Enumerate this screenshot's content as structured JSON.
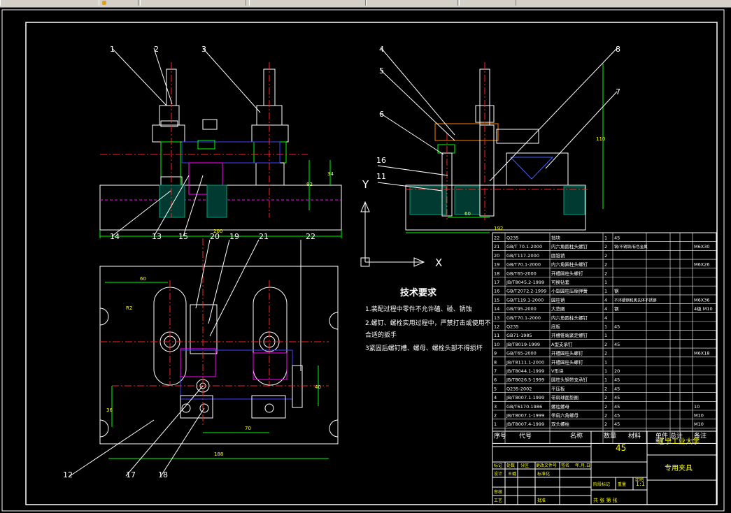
{
  "toolbar": {
    "segments": [
      "",
      "",
      "",
      "",
      "",
      ""
    ]
  },
  "callouts": [
    "1",
    "2",
    "3",
    "4",
    "5",
    "6",
    "7",
    "8",
    "11",
    "12",
    "13",
    "14",
    "15",
    "16",
    "17",
    "18",
    "19",
    "20",
    "21",
    "22"
  ],
  "axes": {
    "y": "Y",
    "x": "X"
  },
  "dims": {
    "d_top_total": "200",
    "d_top_h1": "82",
    "d_top_h2": "34",
    "d_side_h": "110",
    "d_side_w": "192",
    "d_side_60": "60",
    "d_plan_w": "188",
    "d_plan_70": "70",
    "d_plan_60": "60",
    "d_plan_36": "36",
    "d_plan_40": "40",
    "d_plan_r": "R2"
  },
  "tech": {
    "title": "技术要求",
    "line1": "1.装配过程中零件不允许磕、碰、锈蚀",
    "line2": "2.螺钉、螺栓实用过程中，严禁打击或使用不",
    "line3": "合适的扳手",
    "line4": "3紧固后螺钉槽、螺母、螺栓头部不得损坏"
  },
  "bom": {
    "rows": [
      {
        "no": "22",
        "code": "Q235",
        "name": "挡块",
        "qty": "1",
        "mat": "45",
        "note": ""
      },
      {
        "no": "21",
        "code": "GB/T 70.1-2000",
        "name": "内六角圆柱头螺钉",
        "qty": "2",
        "mat": "钢/不锈钢/有色金属",
        "note": "M6X30"
      },
      {
        "no": "20",
        "code": "GB/T117-2000",
        "name": "圆锥销",
        "qty": "2",
        "mat": "",
        "note": ""
      },
      {
        "no": "19",
        "code": "GB/T70.1-2000",
        "name": "内六角圆柱头螺钉",
        "qty": "2",
        "mat": "",
        "note": "M6X26"
      },
      {
        "no": "18",
        "code": "GB/T65-2000",
        "name": "开槽圆柱头螺钉",
        "qty": "2",
        "mat": "",
        "note": ""
      },
      {
        "no": "17",
        "code": "JB/T8045.2-1999",
        "name": "可换钻套",
        "qty": "1",
        "mat": "",
        "note": ""
      },
      {
        "no": "16",
        "code": "GB/T2072.2-1999",
        "name": "小型圆柱压缩弹簧",
        "qty": "1",
        "mat": "钢",
        "note": ""
      },
      {
        "no": "15",
        "code": "GB/T119.1-2000",
        "name": "圆柱销",
        "qty": "4",
        "mat": "不淬硬钢和奥氏体不锈钢",
        "note": "M6X36"
      },
      {
        "no": "14",
        "code": "GB/T95-2000",
        "name": "大垫圈",
        "qty": "4",
        "mat": "钢",
        "note": "4级 M10"
      },
      {
        "no": "13",
        "code": "GB/T70.1-2000",
        "name": "内六角圆柱头螺钉",
        "qty": "4",
        "mat": "",
        "note": ""
      },
      {
        "no": "12",
        "code": "Q235",
        "name": "底板",
        "qty": "1",
        "mat": "45",
        "note": ""
      },
      {
        "no": "11",
        "code": "GB71-1985",
        "name": "开槽锥端紧定螺钉",
        "qty": "1",
        "mat": "",
        "note": ""
      },
      {
        "no": "10",
        "code": "JB/T8019-1999",
        "name": "A型支承钉",
        "qty": "2",
        "mat": "45",
        "note": ""
      },
      {
        "no": "9",
        "code": "GB/T65-2000",
        "name": "开槽圆柱头螺钉",
        "qty": "2",
        "mat": "",
        "note": "M6X18"
      },
      {
        "no": "8",
        "code": "JB/T8111.1-2000",
        "name": "开槽圆柱头螺钉",
        "qty": "1",
        "mat": "",
        "note": ""
      },
      {
        "no": "7",
        "code": "JB/T8044.1-1999",
        "name": "V形块",
        "qty": "1",
        "mat": "20",
        "note": ""
      },
      {
        "no": "6",
        "code": "JB/T8026.5-1999",
        "name": "圆柱头钢带支承钉",
        "qty": "1",
        "mat": "45",
        "note": ""
      },
      {
        "no": "5",
        "code": "Q235-2002",
        "name": "平压板",
        "qty": "2",
        "mat": "45",
        "note": ""
      },
      {
        "no": "4",
        "code": "JB/T8007.1-1999",
        "name": "带肩球面垫圈",
        "qty": "2",
        "mat": "45",
        "note": ""
      },
      {
        "no": "3",
        "code": "GB/T6170-1986",
        "name": "螺柱螺母",
        "qty": "2",
        "mat": "45",
        "note": "10"
      },
      {
        "no": "2",
        "code": "JB/T8007.1-1999",
        "name": "带肩六角螺母",
        "qty": "2",
        "mat": "45",
        "note": "M10"
      },
      {
        "no": "1",
        "code": "JB/T8007.4-1999",
        "name": "双头螺柱",
        "qty": "2",
        "mat": "45",
        "note": "M10"
      }
    ],
    "header": {
      "no": "序号",
      "code": "代号",
      "name": "名称",
      "qty": "数量",
      "mat": "材料",
      "unit1": "单件",
      "unit2": "总计",
      "weight": "重量",
      "note": "备注"
    }
  },
  "titleblock": {
    "material": "45",
    "school": "辽宁工业大学",
    "drawing": "专用夹具",
    "scale": "1:1",
    "r_mark": "标记",
    "r_count": "处数",
    "r_zone": "分区",
    "r_change": "更改文件号",
    "r_sign": "签名",
    "r_date": "年.月.日",
    "design": "设计",
    "standard": "标准化",
    "stage": "阶段标记",
    "weight": "重量",
    "ratio": "比例",
    "review": "审核",
    "craft": "工艺",
    "approve": "批准",
    "sheets": "共    张    第    张",
    "designer": "王璐"
  }
}
